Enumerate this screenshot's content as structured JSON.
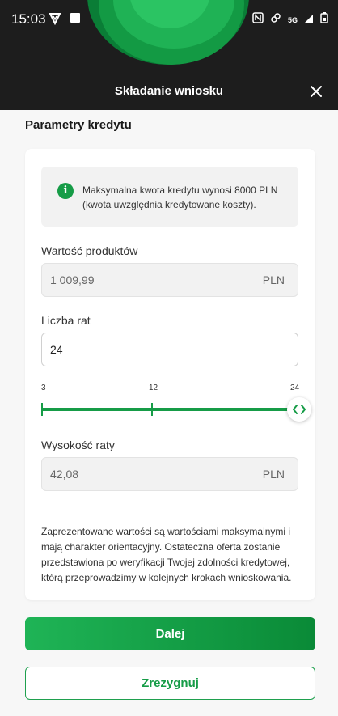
{
  "status_bar": {
    "time": "15:03",
    "network": "5G",
    "icons": [
      "shield-v-icon",
      "square-icon",
      "nfc-icon",
      "link-icon",
      "signal-icon",
      "battery-icon"
    ]
  },
  "header": {
    "title": "Składanie wniosku",
    "close_icon": "close-icon",
    "accent_colors": [
      "#0a7d36",
      "#139a44",
      "#1fb255",
      "#2bc463"
    ]
  },
  "section_title": "Parametry kredytu",
  "info": {
    "icon": "info-icon",
    "text": "Maksymalna kwota kredytu wynosi 8000 PLN (kwota uwzględnia kredytowane koszty)."
  },
  "fields": {
    "product_value": {
      "label": "Wartość produktów",
      "value": "1 009,99",
      "unit": "PLN"
    },
    "installments": {
      "label": "Liczba rat",
      "value": "24"
    },
    "installment_amount": {
      "label": "Wysokość raty",
      "value": "42,08",
      "unit": "PLN"
    }
  },
  "slider": {
    "min_label": "3",
    "mid_label": "12",
    "max_label": "24",
    "value": 24,
    "thumb_icon": "code-arrows-icon"
  },
  "disclaimer": "Zaprezentowane wartości są wartościami maksymalnymi i mają charakter orientacyjny. Ostateczna oferta zostanie przedstawiona po weryfikacji Twojej zdolności kredytowej, którą przeprowadzimy w kolejnych krokach wnioskowania.",
  "buttons": {
    "primary": "Dalej",
    "secondary": "Zrezygnuj"
  },
  "colors": {
    "brand_green": "#169c47",
    "header_bg": "#1d1d1d"
  }
}
